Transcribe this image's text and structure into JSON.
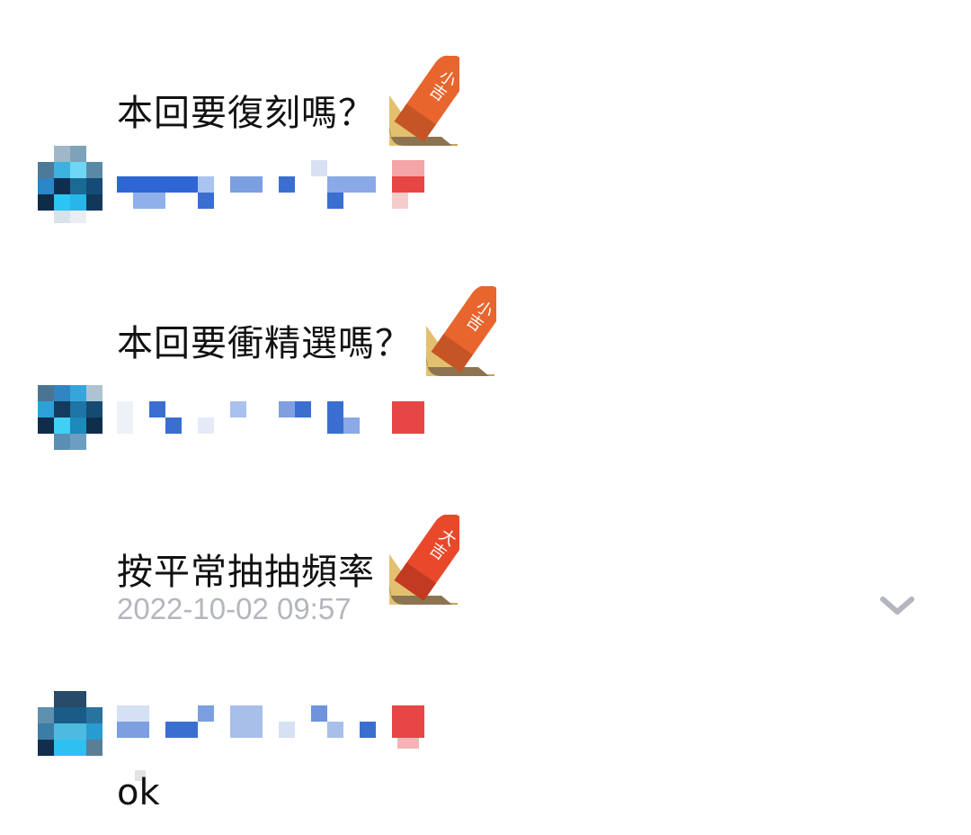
{
  "messages": [
    {
      "text": "本回要復刻嗎？",
      "sticker": "小吉"
    },
    {
      "text": "本回要衝精選嗎？",
      "sticker": "小吉"
    },
    {
      "text": "按平常抽抽頻率",
      "sticker": "大吉",
      "timestamp": "2022-10-02 09:57"
    },
    {
      "text": "ok"
    }
  ],
  "icons": {
    "expand": "chevron-down-icon",
    "sticker": "fortune-stick-icon",
    "avatar": "pixelated-avatar"
  },
  "colors": {
    "stick_orange": "#e8662e",
    "stick_red": "#e9482b",
    "timestamp": "#b3b6bd",
    "name_blue": "#3a6fd0",
    "name_red_tag": "#e84545"
  }
}
